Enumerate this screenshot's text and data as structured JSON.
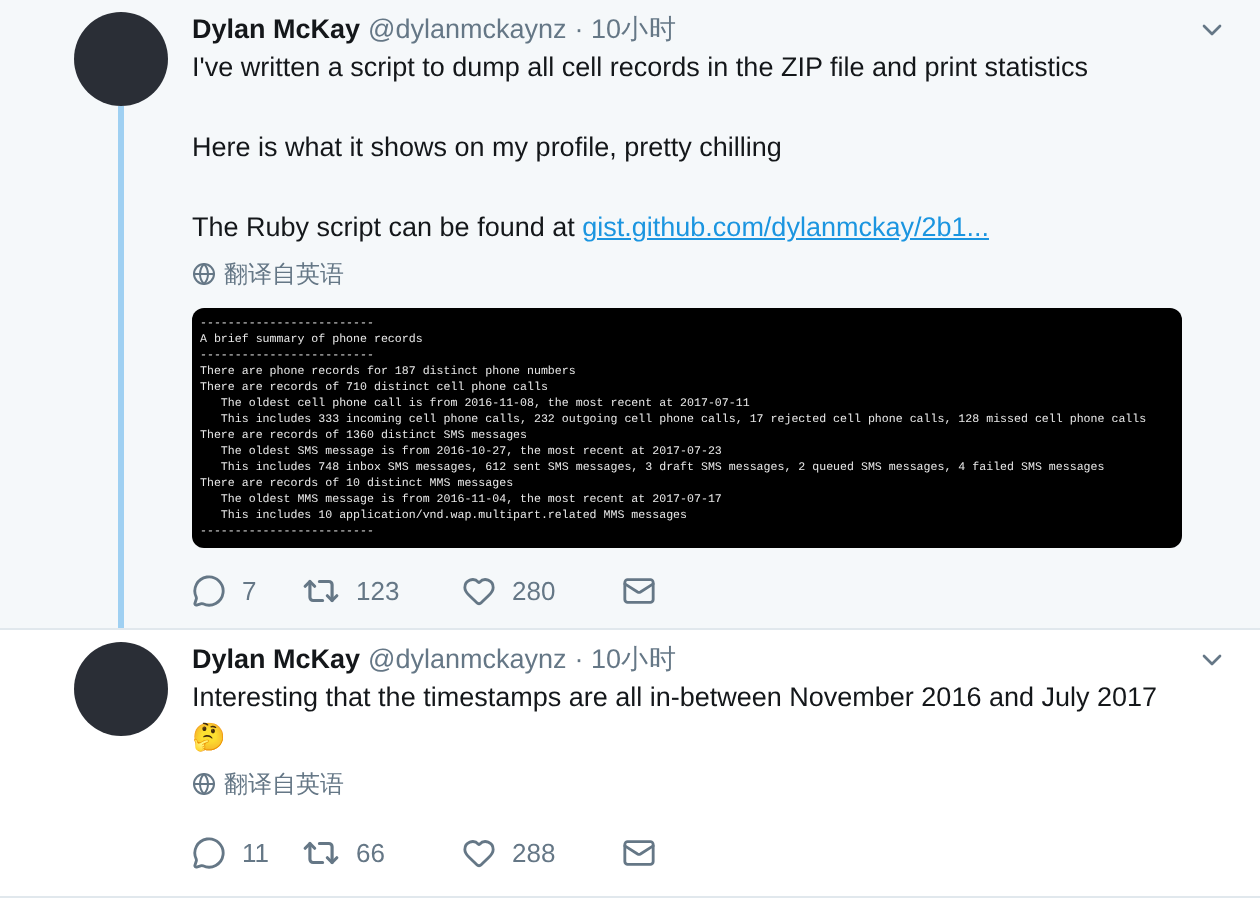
{
  "tweets": [
    {
      "name": "Dylan McKay",
      "handle": "@dylanmckaynz",
      "time": "· 10小时",
      "highlighted": true,
      "thread_below": true,
      "paragraphs": [
        "I've written a script to dump all cell records in the ZIP file and print statistics",
        "Here is what it shows on my profile, pretty chilling"
      ],
      "link_prefix": "The Ruby script can be found at",
      "link": "gist.github.com/dylanmckay/2b1...",
      "translate": "翻译自英语",
      "terminal_lines": [
        "-------------------------",
        "A brief summary of phone records",
        "-------------------------",
        "There are phone records for 187 distinct phone numbers",
        "There are records of 710 distinct cell phone calls",
        "   The oldest cell phone call is from 2016-11-08, the most recent at 2017-07-11",
        "   This includes 333 incoming cell phone calls, 232 outgoing cell phone calls, 17 rejected cell phone calls, 128 missed cell phone calls",
        "There are records of 1360 distinct SMS messages",
        "   The oldest SMS message is from 2016-10-27, the most recent at 2017-07-23",
        "   This includes 748 inbox SMS messages, 612 sent SMS messages, 3 draft SMS messages, 2 queued SMS messages, 4 failed SMS messages",
        "There are records of 10 distinct MMS messages",
        "   The oldest MMS message is from 2016-11-04, the most recent at 2017-07-17",
        "   This includes 10 application/vnd.wap.multipart.related MMS messages",
        "-------------------------"
      ],
      "replies": "7",
      "retweets": "123",
      "likes": "280"
    },
    {
      "name": "Dylan McKay",
      "handle": "@dylanmckaynz",
      "time": "· 10小时",
      "highlighted": false,
      "thread_below": false,
      "paragraphs": [
        "Interesting that the timestamps are all in-between November 2016 and July 2017",
        "🤔"
      ],
      "translate": "翻译自英语",
      "replies": "11",
      "retweets": "66",
      "likes": "288"
    }
  ]
}
